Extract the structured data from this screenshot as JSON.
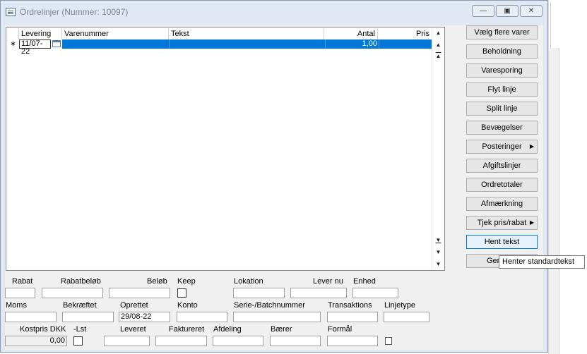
{
  "window": {
    "title": "Ordrelinjer (Nummer: 10097)"
  },
  "grid": {
    "columns": [
      "Levering",
      "Varenummer",
      "Tekst",
      "Antal",
      "Pris"
    ],
    "new_row_marker": "∗",
    "row": {
      "levering": "11/07-22",
      "varenummer": "",
      "tekst": "",
      "antal": "1,00",
      "pris": ""
    }
  },
  "buttons": [
    "Vælg flere varer",
    "Beholdning",
    "Varesporing",
    "Flyt linje",
    "Split linje",
    "Bevægelser",
    "Posteringer",
    "Afgiftslinjer",
    "Ordretotaler",
    "Afmærkning",
    "Tjek pris/rabat",
    "Hent tekst",
    "Gem"
  ],
  "tooltip": "Henter standardtekst",
  "form": {
    "rabat": {
      "label": "Rabat",
      "value": ""
    },
    "rabatbelob": {
      "label": "Rabatbeløb",
      "value": ""
    },
    "belob": {
      "label": "Beløb",
      "value": ""
    },
    "keep": {
      "label": "Keep"
    },
    "lokation": {
      "label": "Lokation",
      "value": ""
    },
    "lever_nu": {
      "label": "Lever nu",
      "value": ""
    },
    "enhed": {
      "label": "Enhed",
      "value": ""
    },
    "moms": {
      "label": "Moms",
      "value": ""
    },
    "bekraeftet": {
      "label": "Bekræftet",
      "value": ""
    },
    "oprettet": {
      "label": "Oprettet",
      "value": "29/08-22"
    },
    "konto": {
      "label": "Konto",
      "value": ""
    },
    "serie": {
      "label": "Serie-/Batchnummer",
      "value": ""
    },
    "transaktions": {
      "label": "Transaktions",
      "value": ""
    },
    "linjetype": {
      "label": "Linjetype",
      "value": ""
    },
    "kostpris": {
      "label": "Kostpris DKK",
      "value": "0,00"
    },
    "lst": {
      "label": "-Lst"
    },
    "leveret": {
      "label": "Leveret",
      "value": ""
    },
    "faktureret": {
      "label": "Faktureret",
      "value": ""
    },
    "afdeling": {
      "label": "Afdeling",
      "value": ""
    },
    "baerer": {
      "label": "Bærer",
      "value": ""
    },
    "formal": {
      "label": "Formål",
      "value": ""
    }
  }
}
